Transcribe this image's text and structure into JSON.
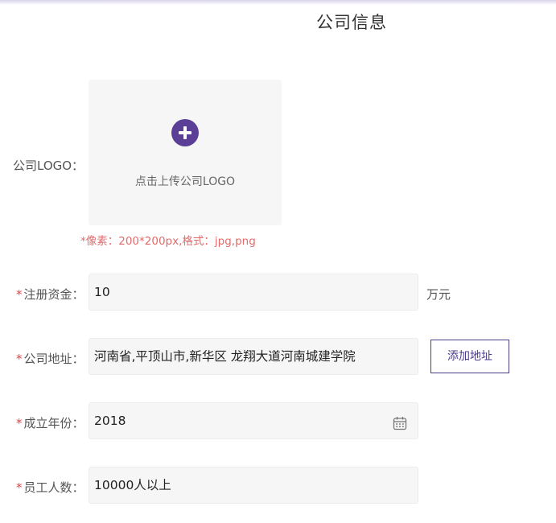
{
  "page": {
    "title": "公司信息"
  },
  "logo": {
    "label": "公司LOGO：",
    "upload_text": "点击上传公司LOGO",
    "hint": "*像素：200*200px,格式：jpg,png",
    "icon": "plus-circle-icon"
  },
  "required_mark": "*",
  "fields": {
    "capital": {
      "label": "注册资金：",
      "value": "10",
      "unit": "万元"
    },
    "address": {
      "label": "公司地址：",
      "value": "河南省,平顶山市,新华区  龙翔大道河南城建学院",
      "button": "添加地址"
    },
    "year": {
      "label": "成立年份：",
      "value": "2018",
      "icon": "calendar-icon"
    },
    "employees": {
      "label": "员工人数：",
      "value": "10000人以上"
    }
  },
  "colors": {
    "accent": "#5b3f96",
    "required": "#e64340",
    "hint": "#e26b6b",
    "field_bg": "#f6f6f6"
  }
}
